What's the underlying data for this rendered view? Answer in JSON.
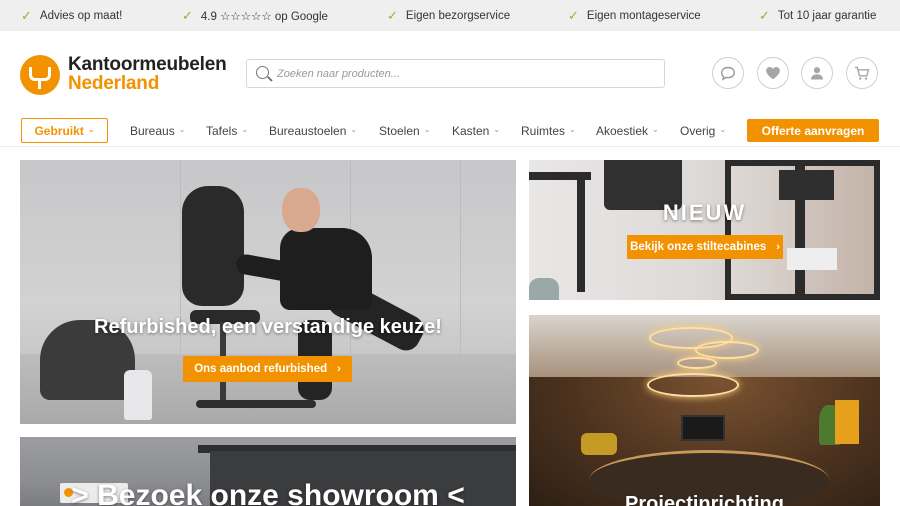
{
  "usp_bar": {
    "items": [
      {
        "text": "Advies op maat!"
      },
      {
        "text": "4.9 ☆☆☆☆☆ op Google"
      },
      {
        "text": "Eigen bezorgservice"
      },
      {
        "text": "Eigen montageservice"
      },
      {
        "text": "Tot 10 jaar garantie"
      }
    ],
    "check_color": "#7dbb33"
  },
  "header": {
    "logo": {
      "line1": "Kantoormeubelen",
      "line2": "Nederland"
    },
    "search": {
      "placeholder": "Zoeken naar producten..."
    },
    "icons": [
      "chat-icon",
      "heart-icon",
      "user-icon",
      "cart-icon"
    ]
  },
  "nav": {
    "used_label": "Gebruikt",
    "items": [
      {
        "label": "Bureaus"
      },
      {
        "label": "Tafels"
      },
      {
        "label": "Bureaustoelen"
      },
      {
        "label": "Stoelen"
      },
      {
        "label": "Kasten"
      },
      {
        "label": "Ruimtes"
      },
      {
        "label": "Akoestiek"
      },
      {
        "label": "Overig"
      }
    ],
    "cta_label": "Offerte aanvragen"
  },
  "banners": {
    "refurbished": {
      "title": "Refurbished, een verstandige keuze!",
      "cta": "Ons aanbod refurbished"
    },
    "nieuw": {
      "title": "NIEUW",
      "cta": "Bekijk onze stiltecabines"
    },
    "showroom": {
      "title": "> Bezoek onze showroom <"
    },
    "projectinrichting": {
      "title": "Projectinrichting"
    }
  },
  "colors": {
    "accent": "#f39200",
    "check": "#7dbb33"
  }
}
